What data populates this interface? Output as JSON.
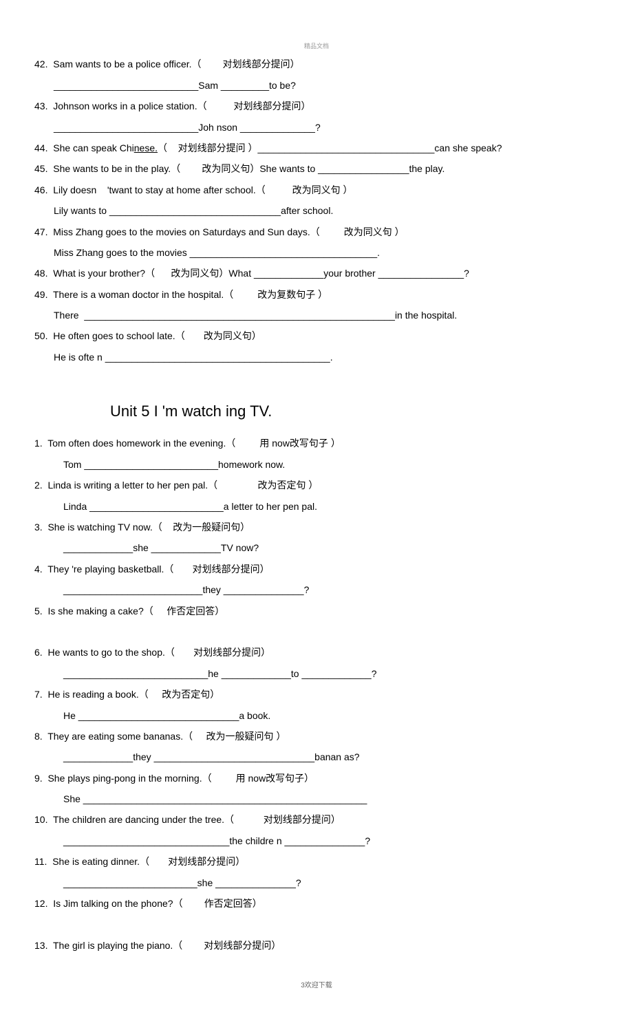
{
  "header_tag": "精品文档",
  "top_items": [
    {
      "num": "42.",
      "text": "Sam wants to be a police officer.（        对划线部分提问）"
    },
    {
      "indent": true,
      "text": "___________________________Sam _________to be?"
    },
    {
      "num": "43.",
      "text": "Johnson works in a police station.（          对划线部分提问）"
    },
    {
      "indent": true,
      "text": "___________________________Joh nson ______________?"
    },
    {
      "num": "44.",
      "text": "She can speak Chi",
      "underline_word": "nese.",
      "after": "（    对划线部分提问 ）_________________________________can she speak?"
    },
    {
      "num": "45.",
      "text": "She wants to be in the play.（        改为同义句）She wants to _________________the play."
    },
    {
      "num": "46.",
      "text": "Lily doesn    'twant to stay at home after school.（          改为同义句 ）"
    },
    {
      "indent": true,
      "text": "Lily wants to ________________________________after school."
    },
    {
      "num": "47.",
      "text": "Miss Zhang goes to the movies on Saturdays and Sun days.（         改为同义句 ）"
    },
    {
      "indent": true,
      "text": "Miss Zhang goes to the movies ___________________________________."
    },
    {
      "num": "48.",
      "text": "What is your brother?（      改为同义句）What _____________your brother ________________?"
    },
    {
      "num": "49.",
      "text": "There is a woman doctor in the hospital.（         改为复数句子 ）"
    },
    {
      "indent": true,
      "text": "There  __________________________________________________________in the hospital."
    },
    {
      "num": "50.",
      "text": "He often goes to school late.（       改为同义句）"
    },
    {
      "indent": true,
      "text": "He is ofte n __________________________________________."
    }
  ],
  "unit_title": "Unit 5 I 'm watch ing TV.",
  "bottom_items": [
    {
      "num": "1.",
      "text": "Tom often does homework in the evening.（         用 now改写句子 ）"
    },
    {
      "indent2": true,
      "text": "Tom _________________________homework now."
    },
    {
      "num": "2.",
      "text": "Linda is writing a letter to her pen pal.（               改为否定句 ）"
    },
    {
      "indent2": true,
      "text": "Linda _________________________a letter to her pen pal."
    },
    {
      "num": "3.",
      "text": "She is watching TV now.（    改为一般疑问句）"
    },
    {
      "indent2": true,
      "text": "_____________she _____________TV now?"
    },
    {
      "num": "4.",
      "text": "They 're playing basketball.（       对划线部分提问）"
    },
    {
      "indent2": true,
      "text": "__________________________they _______________?"
    },
    {
      "num": "5.",
      "text": "Is she making a cake?（     作否定回答）"
    },
    {
      "blank": true
    },
    {
      "num": "6.",
      "text": "He wants to go to the shop.（       对划线部分提问）"
    },
    {
      "indent2": true,
      "text": "___________________________he _____________to _____________?"
    },
    {
      "num": "7.",
      "text": "He is reading a book.（     改为否定句）"
    },
    {
      "indent2": true,
      "text": "He ______________________________a book."
    },
    {
      "num": "8.",
      "text": "They are eating some bananas.（     改为一般疑问句 ）"
    },
    {
      "indent2": true,
      "text": "_____________they ______________________________banan as?"
    },
    {
      "num": "9.",
      "text": "She plays ping-pong in the morning.（         用 now改写句子）"
    },
    {
      "indent2": true,
      "text": "She _____________________________________________________"
    },
    {
      "num": "10.",
      "text": "The children are dancing under the tree.（           对划线部分提问）"
    },
    {
      "indent2": true,
      "text": "_______________________________the childre n _______________?"
    },
    {
      "num": "11.",
      "text": "She is eating dinner.（       对划线部分提问）"
    },
    {
      "indent2": true,
      "text": "_________________________she _______________?"
    },
    {
      "num": "12.",
      "text": "Is Jim talking on the phone?（        作否定回答）"
    },
    {
      "blank": true
    },
    {
      "num": "13.",
      "text": "The girl is playing the piano.（        对划线部分提问）"
    }
  ],
  "page_num": "3",
  "footer_tag": "欢迎下载"
}
